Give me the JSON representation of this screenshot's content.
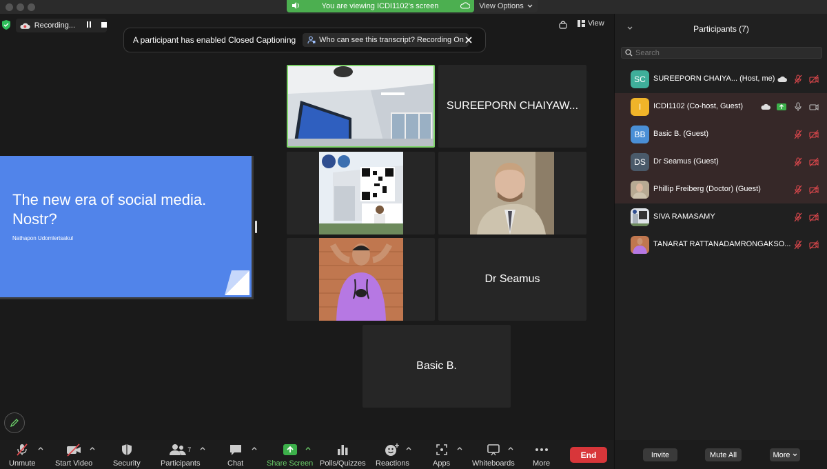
{
  "share_banner": {
    "text": "You are viewing ICDI1102's screen",
    "view_options": "View Options"
  },
  "recording": {
    "label": "Recording..."
  },
  "caption_banner": {
    "text": "A participant has enabled Closed Captioning",
    "who_link": "Who can see this transcript? Recording On"
  },
  "view_button": "View",
  "slide": {
    "title_line1": "The new era of social media.",
    "title_line2": "Nostr?",
    "author": "Nathapon Udomlertsakul"
  },
  "tiles": {
    "sureeporn": "SUREEPORN CHAIYAW...",
    "dr_seamus": "Dr Seamus",
    "basic_b": "Basic B."
  },
  "toolbar": {
    "unmute": "Unmute",
    "start_video": "Start Video",
    "security": "Security",
    "participants": "Participants",
    "participants_count": "7",
    "chat": "Chat",
    "share_screen": "Share Screen",
    "polls": "Polls/Quizzes",
    "reactions": "Reactions",
    "apps": "Apps",
    "whiteboards": "Whiteboards",
    "more": "More",
    "end": "End"
  },
  "panel": {
    "title": "Participants (7)",
    "search_placeholder": "Search",
    "participants": [
      {
        "initials": "SC",
        "name": "SUREEPORN CHAIYA...  (Host, me)",
        "avatar_color": "#3fae9a"
      },
      {
        "initials": "I",
        "name": "ICDI1102 (Co-host, Guest)",
        "avatar_color": "#f0b429"
      },
      {
        "initials": "BB",
        "name": "Basic B. (Guest)",
        "avatar_color": "#4a8fd6"
      },
      {
        "initials": "DS",
        "name": "Dr Seamus (Guest)",
        "avatar_color": "#4a5a6a"
      },
      {
        "initials": "",
        "name": "Phillip Freiberg (Doctor) (Guest)",
        "avatar_color": "#8a7a6a"
      },
      {
        "initials": "",
        "name": "SIVA RAMASAMY",
        "avatar_color": "#5a6a7a"
      },
      {
        "initials": "",
        "name": "TANARAT RATTANADAMRONGAKSO...",
        "avatar_color": "#b07a9a"
      }
    ],
    "invite": "Invite",
    "mute_all": "Mute All",
    "more": "More"
  },
  "colors": {
    "accent_green": "#4caf50",
    "end_red": "#d8363a",
    "slide_blue": "#5184ea",
    "muted_red": "#e0484d"
  }
}
